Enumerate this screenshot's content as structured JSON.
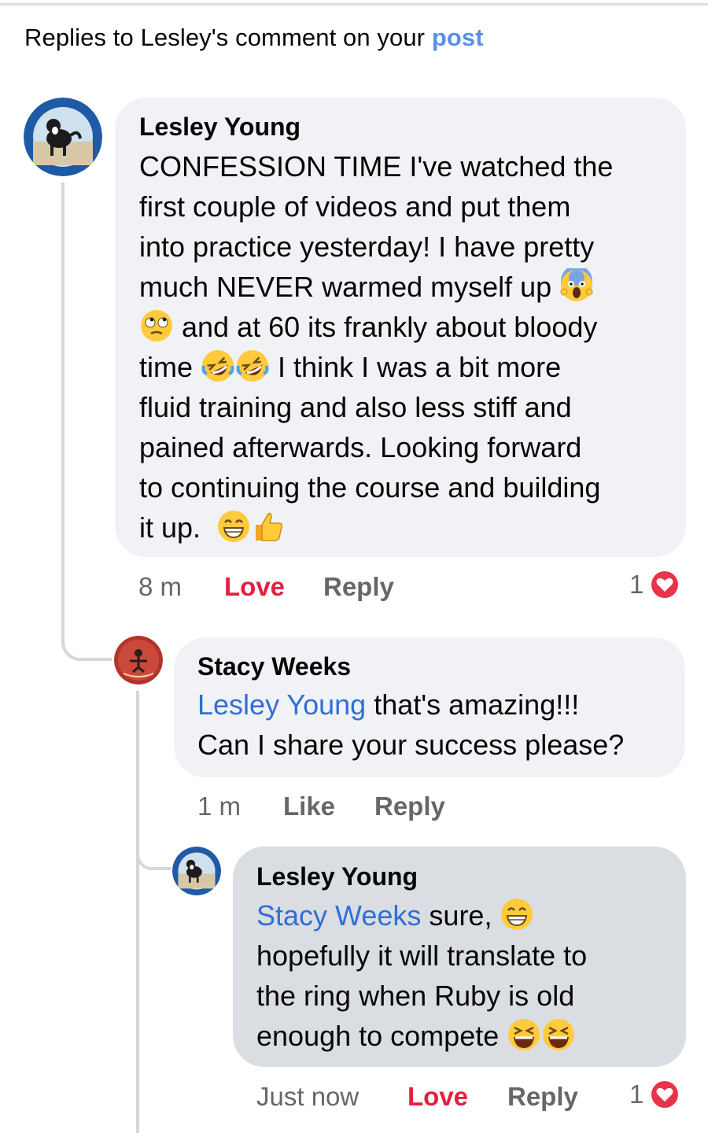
{
  "header": {
    "text": "Replies to Lesley's comment on your ",
    "link": "post"
  },
  "comments": [
    {
      "author": "Lesley Young",
      "lines": [
        "CONFESSION TIME I've watched the",
        "first couple of videos and put them",
        "into practice yesterday!   I have pretty",
        "much NEVER warmed myself up",
        "and at 60 its frankly about bloody",
        "time",
        "I think I was a bit more",
        "fluid training and also less stiff and",
        "pained afterwards.  Looking forward",
        "to continuing the course and building",
        "it up."
      ],
      "emojis": [
        "scream-emoji",
        "rolling-eyes-emoji",
        "rofl-emoji",
        "grin-emoji",
        "thumbs-up-emoji"
      ],
      "time": "8 m",
      "reaction_label": "Love",
      "reply_label": "Reply",
      "reaction_count": "1",
      "reaction_icon": "heart-icon"
    },
    {
      "author": "Stacy Weeks",
      "mention": "Lesley Young",
      "text_after_mention": " that's amazing!!!",
      "line2": "Can I share your success please?",
      "time": "1 m",
      "reaction_label": "Like",
      "reply_label": "Reply"
    },
    {
      "author": "Lesley Young",
      "mention": "Stacy Weeks",
      "text_after_mention": " sure,",
      "lines": [
        "hopefully it will translate to",
        "the ring when Ruby is old",
        "enough to compete"
      ],
      "emojis": [
        "grin-emoji",
        "laughing-emoji"
      ],
      "time": "Just now",
      "reaction_label": "Love",
      "reply_label": "Reply",
      "reaction_count": "1",
      "reaction_icon": "heart-icon"
    }
  ],
  "colors": {
    "bubble": "#f0f2f5",
    "highlight_bubble": "#dadde1",
    "mention": "#2f6fd6",
    "header_link": "#5b8fe6",
    "love": "#e41e3f",
    "meta": "#65676b"
  }
}
